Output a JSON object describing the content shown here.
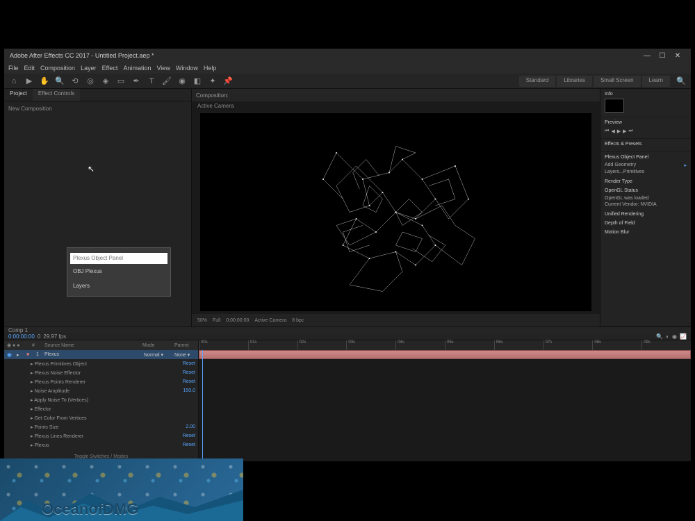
{
  "window": {
    "title": "Adobe After Effects CC 2017 - Untitled Project.aep *"
  },
  "menus": [
    "File",
    "Edit",
    "Composition",
    "Layer",
    "Effect",
    "Animation",
    "View",
    "Window",
    "Help"
  ],
  "workspaces": [
    "Standard",
    "Libraries",
    "Small Screen",
    "Learn"
  ],
  "project_panel": {
    "tabs": [
      "Project",
      "Effect Controls"
    ],
    "new_comp_label": "New Composition"
  },
  "search_popup": {
    "placeholder": "Plexus Object Panel",
    "item1": "OBJ Plexus",
    "item2": "Layers"
  },
  "composition": {
    "tab": "Composition:",
    "active_camera": "Active Camera",
    "zoom": "50%",
    "resolution": "Full",
    "timecode": "0:00:00:00",
    "color_mgmt": "8 bpc"
  },
  "right_panel": {
    "info_header": "Info",
    "preview_header": "Preview",
    "effects_header": "Effects & Presets",
    "plexus_header": "Plexus Object Panel",
    "add_geometry": "Add Geometry",
    "render_header": "Render Type",
    "layer_primitives": "Layers...Primitives",
    "opengl_header": "OpenGL Status",
    "gpu_line1": "OpenGL was loaded",
    "gpu_line2": "Current Vendor: NVIDIA",
    "unified_header": "Unified Rendering",
    "depth_header": "Depth of Field",
    "motion_header": "Motion Blur"
  },
  "timeline": {
    "comp_name": "Comp 1",
    "timecode": "0:00:00:00",
    "frame_label": "0",
    "fps_label": "29.97 fps",
    "ruler_marks": [
      "00s",
      "01s",
      "02s",
      "03s",
      "04s",
      "05s",
      "06s",
      "07s",
      "08s",
      "09s"
    ],
    "columns": {
      "source": "Source Name",
      "mode": "Mode",
      "parent": "Parent"
    },
    "layers": [
      {
        "idx": "1",
        "name": "Plexus",
        "mode": "Normal",
        "selected": true
      },
      {
        "prop": true,
        "name": "Plexus Primitives Object",
        "val": "Reset"
      },
      {
        "prop": true,
        "name": "Plexus Noise Effector",
        "val": "Reset"
      },
      {
        "prop": true,
        "name": "Plexus Points Renderer",
        "val": "Reset"
      },
      {
        "prop": true,
        "name": "Noise Amplitude",
        "val": "150.0"
      },
      {
        "prop": true,
        "name": "Apply Noise To (Vertices)",
        "val": ""
      },
      {
        "prop": true,
        "name": "Effector",
        "val": ""
      },
      {
        "prop": true,
        "name": "Get Color From Vertices",
        "val": ""
      },
      {
        "prop": true,
        "name": "Points Size",
        "val": "2.00"
      },
      {
        "prop": true,
        "name": "Plexus Lines Renderer",
        "val": "Reset"
      },
      {
        "prop": true,
        "name": "Plexus",
        "val": "Reset"
      }
    ],
    "toggle_label": "Toggle Switches / Modes"
  },
  "watermark": "OceanofDMG"
}
